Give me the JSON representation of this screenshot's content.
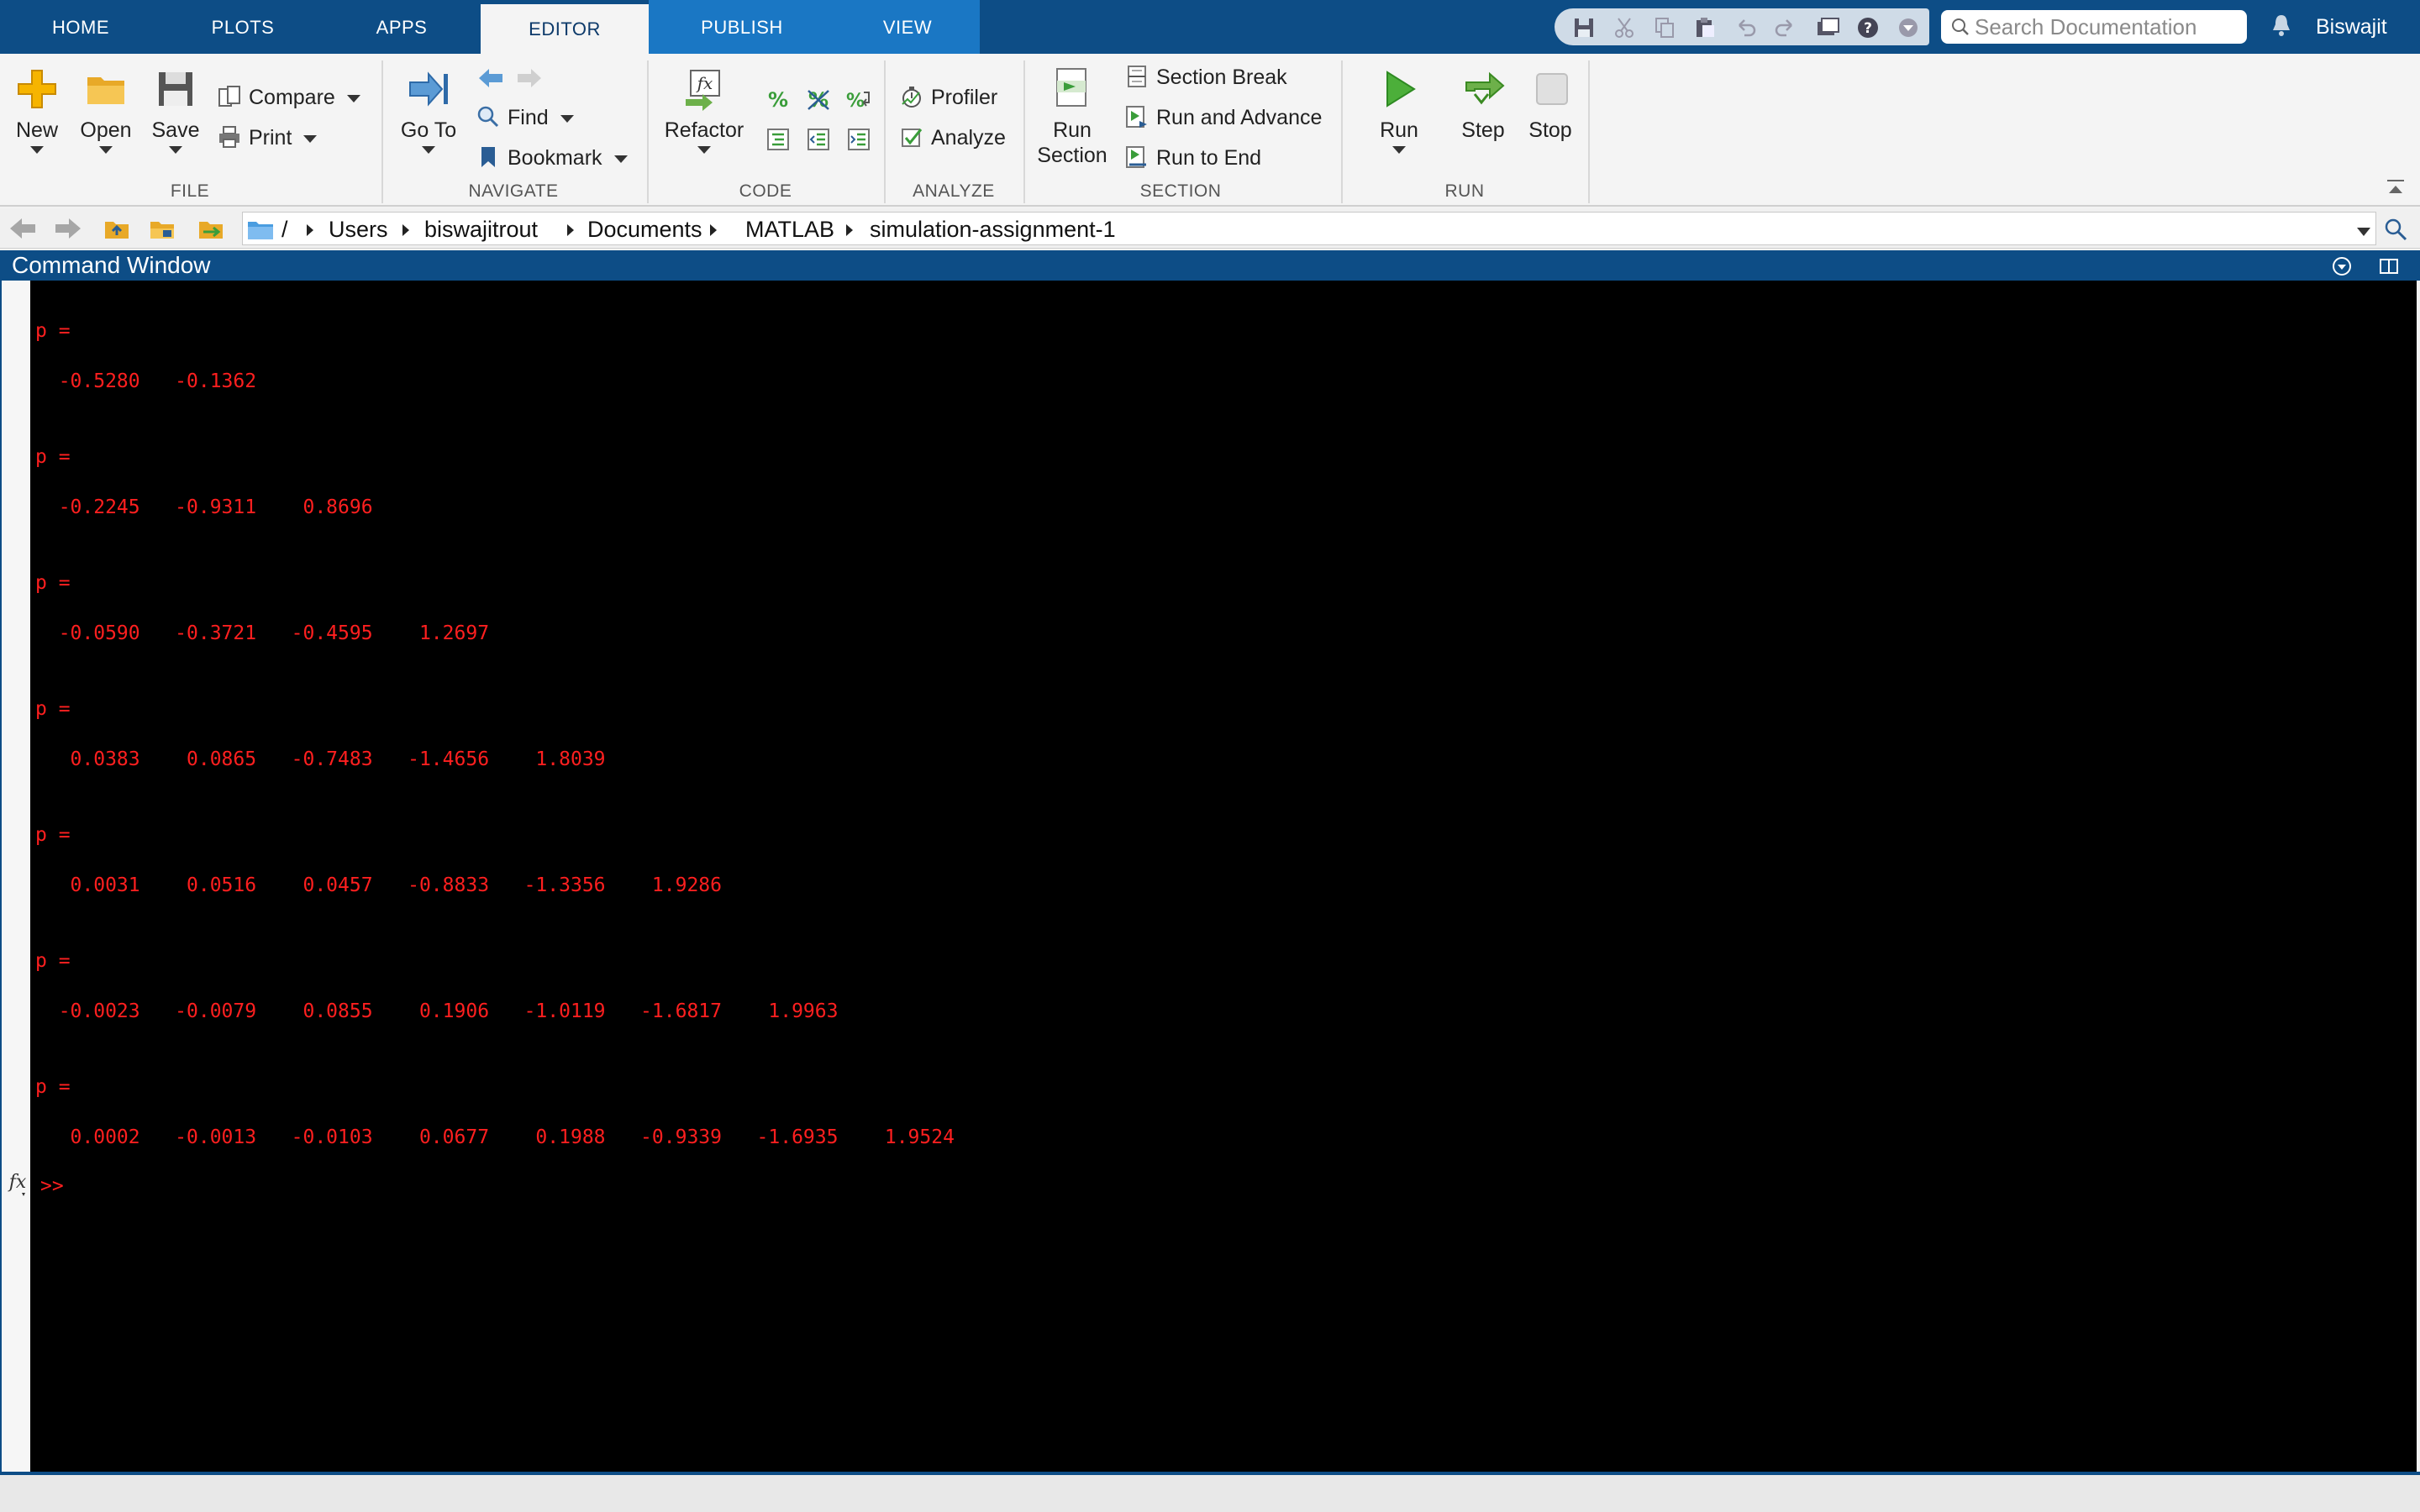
{
  "tabs": [
    "HOME",
    "PLOTS",
    "APPS",
    "EDITOR",
    "PUBLISH",
    "VIEW"
  ],
  "search": {
    "placeholder": "Search Documentation"
  },
  "user": {
    "name": "Biswajit"
  },
  "ribbon": {
    "file": {
      "label": "FILE",
      "new": "New",
      "open": "Open",
      "save": "Save",
      "compare": "Compare",
      "print": "Print"
    },
    "navigate": {
      "label": "NAVIGATE",
      "goto": "Go To",
      "find": "Find",
      "bookmark": "Bookmark"
    },
    "code": {
      "label": "CODE",
      "refactor": "Refactor"
    },
    "analyze": {
      "label": "ANALYZE",
      "profiler": "Profiler",
      "analyze": "Analyze"
    },
    "section": {
      "label": "SECTION",
      "run_section_1": "Run",
      "run_section_2": "Section",
      "section_break": "Section Break",
      "run_and_advance": "Run and Advance",
      "run_to_end": "Run to End"
    },
    "run": {
      "label": "RUN",
      "run": "Run",
      "step": "Step",
      "stop": "Stop"
    }
  },
  "path": {
    "root": "/",
    "crumbs": [
      "Users",
      "biswajitrout",
      "Documents",
      "MATLAB",
      "simulation-assignment-1"
    ]
  },
  "command_window": {
    "title": "Command Window",
    "outputs": [
      {
        "label": "p =",
        "values": "  -0.5280   -0.1362"
      },
      {
        "label": "p =",
        "values": "  -0.2245   -0.9311    0.8696"
      },
      {
        "label": "p =",
        "values": "  -0.0590   -0.3721   -0.4595    1.2697"
      },
      {
        "label": "p =",
        "values": "   0.0383    0.0865   -0.7483   -1.4656    1.8039"
      },
      {
        "label": "p =",
        "values": "   0.0031    0.0516    0.0457   -0.8833   -1.3356    1.9286"
      },
      {
        "label": "p =",
        "values": "  -0.0023   -0.0079    0.0855    0.1906   -1.0119   -1.6817    1.9963"
      },
      {
        "label": "p =",
        "values": "   0.0002   -0.0013   -0.0103    0.0677    0.1988   -0.9339   -1.6935    1.9524"
      }
    ],
    "prompt": ">>"
  },
  "colors": {
    "accent": "#0d4d86",
    "console_bg": "#000000",
    "console_text": "#ff1f1f"
  }
}
